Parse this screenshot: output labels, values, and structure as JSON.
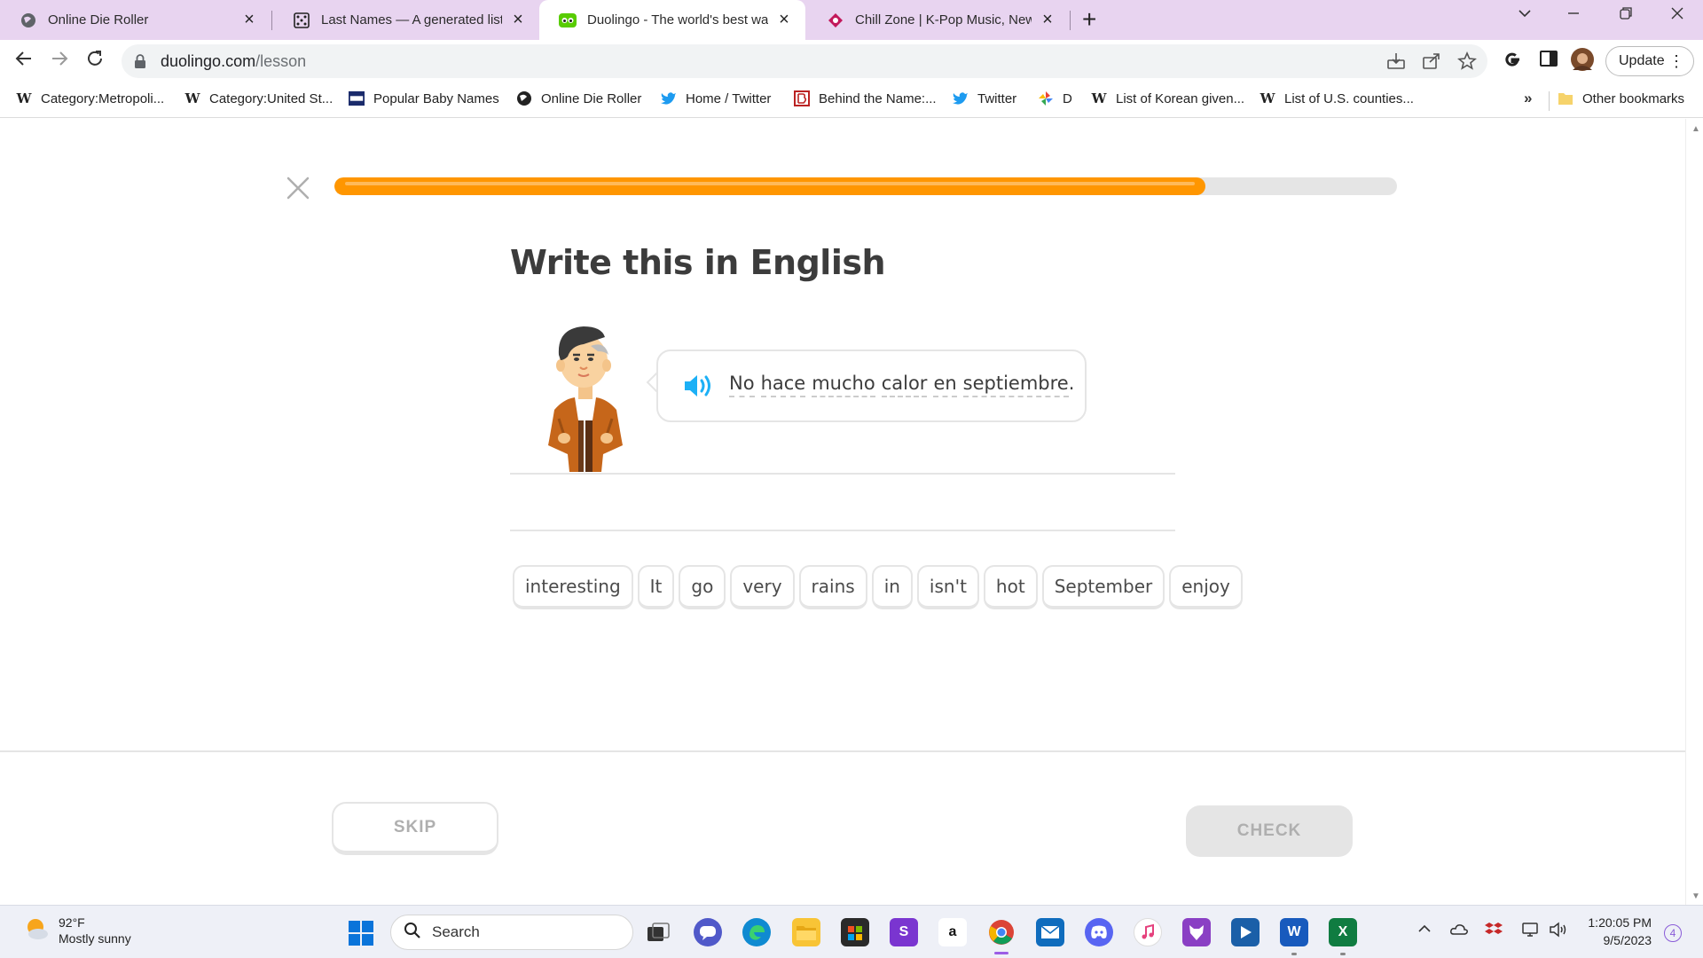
{
  "browser": {
    "tabs": [
      {
        "title": "Online Die Roller",
        "favicon": "globe-icon",
        "active": false
      },
      {
        "title": "Last Names — A generated list o",
        "favicon": "dice-icon",
        "active": false
      },
      {
        "title": "Duolingo - The world's best way",
        "favicon": "duolingo-icon",
        "active": true
      },
      {
        "title": "Chill Zone | K-Pop Music, News, a",
        "favicon": "chill-zone-icon",
        "active": false
      }
    ],
    "new_tab_symbol": "+",
    "close_symbol": "×",
    "address": {
      "host": "duolingo.com",
      "path": "/lesson"
    },
    "update_label": "Update",
    "bookmarks": [
      {
        "label": "Category:Metropoli...",
        "icon": "wikipedia-icon"
      },
      {
        "label": "Category:United St...",
        "icon": "wikipedia-icon"
      },
      {
        "label": "Popular Baby Names",
        "icon": "ssa-icon"
      },
      {
        "label": "Online Die Roller",
        "icon": "globe-icon"
      },
      {
        "label": "Home / Twitter",
        "icon": "twitter-icon"
      },
      {
        "label": "Behind the Name:...",
        "icon": "behind-the-name-icon"
      },
      {
        "label": "Twitter",
        "icon": "twitter-icon"
      },
      {
        "label": "D",
        "icon": "pinwheel-icon"
      },
      {
        "label": "List of Korean given...",
        "icon": "wikipedia-icon"
      },
      {
        "label": "List of U.S. counties...",
        "icon": "wikipedia-icon"
      }
    ],
    "bookmarks_overflow": "»",
    "other_bookmarks": "Other bookmarks"
  },
  "lesson": {
    "progress": 0.82,
    "colors": {
      "progress": "#ff9600",
      "speaker": "#1cb0f6",
      "text": "#3c3c3c"
    },
    "heading": "Write this in English",
    "prompt_words": [
      "No",
      "hace",
      "mucho",
      "calor",
      "en",
      "septiembre"
    ],
    "prompt_punct": ".",
    "word_bank": [
      "interesting",
      "It",
      "go",
      "very",
      "rains",
      "in",
      "isn't",
      "hot",
      "September",
      "enjoy"
    ],
    "skip_label": "SKIP",
    "check_label": "CHECK"
  },
  "taskbar": {
    "weather": {
      "temp": "92°F",
      "condition": "Mostly sunny"
    },
    "search_label": "Search",
    "apps": [
      "task-view-icon",
      "teams-chat-icon",
      "edge-icon",
      "file-explorer-icon",
      "microsoft-store-icon",
      "scrivener-icon",
      "amazon-icon",
      "chrome-icon",
      "mail-icon",
      "discord-icon",
      "itunes-icon",
      "wolf-app-icon",
      "media-player-icon",
      "word-icon",
      "excel-icon"
    ],
    "clock": {
      "time": "1:20:05 PM",
      "date": "9/5/2023"
    },
    "notifications": "4"
  }
}
